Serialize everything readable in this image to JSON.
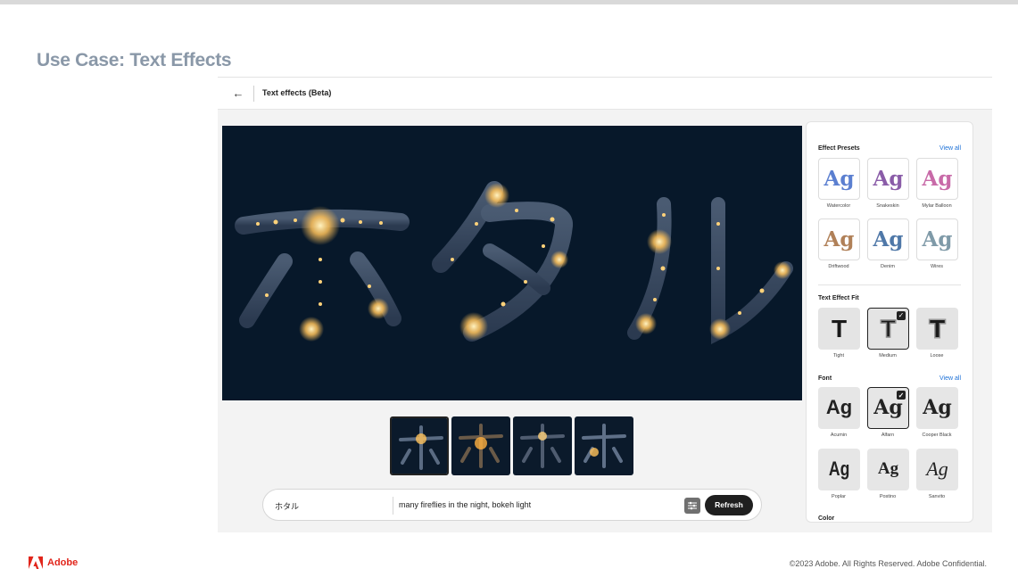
{
  "slide": {
    "title": "Use Case: Text Effects",
    "brand": "Adobe",
    "copyright": "©2023 Adobe. All Rights Reserved. Adobe Confidential."
  },
  "app": {
    "header_title": "Text effects (Beta)",
    "canvas_text": "ホタル",
    "thumbnail_count": 4
  },
  "prompt": {
    "text_value": "ホタル",
    "description_value": "many fireflies in the night, bokeh light",
    "refresh_label": "Refresh"
  },
  "panel": {
    "presets": {
      "title": "Effect Presets",
      "view_all": "View all",
      "items": [
        {
          "label": "Watercolor",
          "sample": "Ag",
          "color": "#5b7fd0"
        },
        {
          "label": "Snakeskin",
          "sample": "Ag",
          "color": "#8a5ca8"
        },
        {
          "label": "Mylar Balloon",
          "sample": "Ag",
          "color": "#c86aa8"
        },
        {
          "label": "Driftwood",
          "sample": "Ag",
          "color": "#b08058"
        },
        {
          "label": "Denim",
          "sample": "Ag",
          "color": "#4f78a8"
        },
        {
          "label": "Wires",
          "sample": "Ag",
          "color": "#7f9aa8"
        }
      ]
    },
    "fit": {
      "title": "Text Effect Fit",
      "items": [
        {
          "label": "Tight",
          "glyph": "T"
        },
        {
          "label": "Medium",
          "glyph": "T"
        },
        {
          "label": "Loose",
          "glyph": "T"
        }
      ],
      "selected": "Medium"
    },
    "font": {
      "title": "Font",
      "view_all": "View all",
      "items": [
        {
          "label": "Acumin",
          "sample": "Ag"
        },
        {
          "label": "Alfarn",
          "sample": "Ag"
        },
        {
          "label": "Cooper Black",
          "sample": "Ag"
        },
        {
          "label": "Poplar",
          "sample": "Ag"
        },
        {
          "label": "Postino",
          "sample": "Ag"
        },
        {
          "label": "Sanvito",
          "sample": "Ag"
        }
      ],
      "selected": "Alfarn"
    },
    "color": {
      "title": "Color"
    }
  },
  "colors": {
    "canvas_bg": "#07182a",
    "glow": "#ffc25a",
    "accent_link": "#1a6fd6",
    "adobe_red": "#e1251b"
  }
}
